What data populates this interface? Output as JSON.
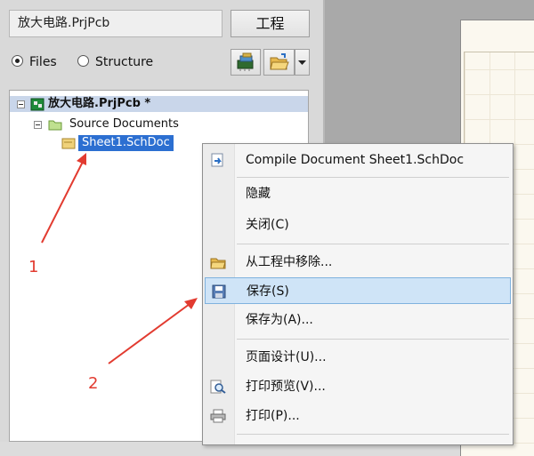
{
  "left_panel": {
    "path_value": "放大电路.PrjPcb",
    "project_button": "工程",
    "radio_files": "Files",
    "radio_structure": "Structure",
    "tree": [
      {
        "label": "放大电路.PrjPcb *"
      },
      {
        "label": "Source Documents"
      },
      {
        "label": "Sheet1.SchDoc"
      }
    ]
  },
  "context_menu": {
    "items": [
      {
        "label": "Compile Document Sheet1.SchDoc",
        "icon": "compile-icon"
      },
      {
        "label": "隐藏",
        "icon": ""
      },
      {
        "label": "关闭(C)",
        "icon": ""
      },
      {
        "label": "从工程中移除...",
        "icon": "folder-remove-icon"
      },
      {
        "label": "保存(S)",
        "icon": "save-icon",
        "highlighted": true
      },
      {
        "label": "保存为(A)...",
        "icon": ""
      },
      {
        "label": "页面设计(U)...",
        "icon": ""
      },
      {
        "label": "打印预览(V)...",
        "icon": "print-preview-icon"
      },
      {
        "label": "打印(P)...",
        "icon": "print-icon"
      }
    ]
  },
  "annotations": {
    "label_1": "1",
    "label_2": "2"
  },
  "colors": {
    "selection": "#3a7bd5",
    "menu_highlight": "#cfe4f7",
    "annotation": "#e23b30"
  }
}
